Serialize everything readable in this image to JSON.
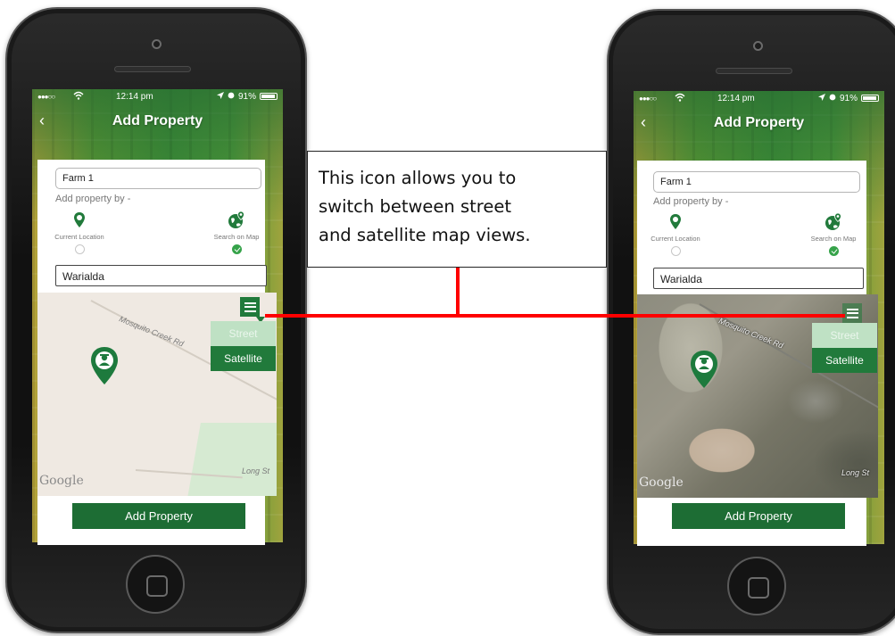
{
  "phones": [
    {
      "variant": "street",
      "status": {
        "signal": "●●●○○",
        "time": "12:14 pm",
        "battery": "91%"
      },
      "nav_title": "Add Property",
      "property_name": "Farm 1",
      "add_by_label": "Add property by -",
      "option_current": "Current Location",
      "option_map": "Search on Map",
      "search_value": "Warialda",
      "road_label_1": "Mosquito Creek Rd",
      "road_label_2": "Long St",
      "map_logo": "Google",
      "map_type_street": "Street",
      "map_type_satellite": "Satellite",
      "add_button": "Add Property"
    },
    {
      "variant": "satellite",
      "status": {
        "signal": "●●●○○",
        "time": "12:14 pm",
        "battery": "91%"
      },
      "nav_title": "Add Property",
      "property_name": "Farm 1",
      "add_by_label": "Add property by -",
      "option_current": "Current Location",
      "option_map": "Search on Map",
      "search_value": "Warialda",
      "road_label_1": "Mosquito Creek Rd",
      "road_label_2": "Long St",
      "map_logo": "Google",
      "map_type_street": "Street",
      "map_type_satellite": "Satellite",
      "add_button": "Add Property"
    }
  ],
  "callout": {
    "line1": "This icon allows you to",
    "line2": "switch between street",
    "line3": "and satellite map views."
  },
  "colors": {
    "brand_green": "#217a3b",
    "button_green": "#1d6d34",
    "check_green": "#36a34a",
    "connector_red": "#ff0000"
  },
  "icons": [
    "back-icon",
    "location-pin-icon",
    "globe-pin-icon",
    "layers-icon",
    "farmer-pin-icon",
    "wifi-icon",
    "location-arrow-icon",
    "battery-icon"
  ]
}
